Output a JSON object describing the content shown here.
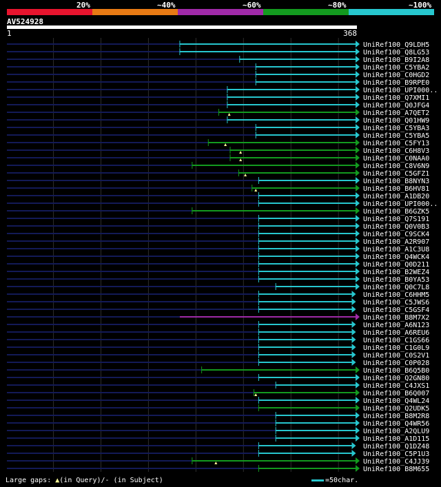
{
  "legend": [
    {
      "label": "20%",
      "color": "#e8142e"
    },
    {
      "label": "~40%",
      "color": "#e87a14"
    },
    {
      "label": "~60%",
      "color": "#a02aa8"
    },
    {
      "label": "~80%",
      "color": "#139a1f"
    },
    {
      "label": "~100%",
      "color": "#27c7cf"
    }
  ],
  "query": {
    "id": "AV524928",
    "length": 368,
    "start_label": "1",
    "end_label": "368"
  },
  "colors": {
    "cyan": "#27c7cf",
    "green": "#139a1f",
    "purple": "#a02aa8",
    "navy": "#131a57",
    "gap": "#ffff99"
  },
  "hits": [
    {
      "name": "UniRef100_Q9LDH5",
      "start": 183,
      "end": 368,
      "color": "cyan",
      "vline": true,
      "gaps": []
    },
    {
      "name": "UniRef100_Q8LG53",
      "start": 183,
      "end": 368,
      "color": "cyan",
      "vline": true,
      "gaps": []
    },
    {
      "name": "UniRef100_B9I2A8",
      "start": 246,
      "end": 368,
      "color": "cyan",
      "vline": true,
      "gaps": []
    },
    {
      "name": "UniRef100_C5YBA2",
      "start": 263,
      "end": 368,
      "color": "cyan",
      "vline": true,
      "gaps": []
    },
    {
      "name": "UniRef100_C0HGD2",
      "start": 263,
      "end": 368,
      "color": "cyan",
      "vline": true,
      "gaps": []
    },
    {
      "name": "UniRef100_B9RPE0",
      "start": 263,
      "end": 368,
      "color": "cyan",
      "vline": true,
      "gaps": []
    },
    {
      "name": "UniRef100_UPI000..",
      "start": 233,
      "end": 368,
      "color": "cyan",
      "vline": true,
      "gaps": []
    },
    {
      "name": "UniRef100_Q7XMI1",
      "start": 233,
      "end": 368,
      "color": "cyan",
      "vline": true,
      "gaps": []
    },
    {
      "name": "UniRef100_Q0JFG4",
      "start": 233,
      "end": 368,
      "color": "cyan",
      "vline": true,
      "gaps": []
    },
    {
      "name": "UniRef100_A7QET2",
      "start": 224,
      "end": 368,
      "color": "green",
      "vline": true,
      "gaps": [
        235
      ]
    },
    {
      "name": "UniRef100_Q01HW9",
      "start": 233,
      "end": 368,
      "color": "cyan",
      "vline": true,
      "gaps": []
    },
    {
      "name": "UniRef100_C5YBA3",
      "start": 263,
      "end": 368,
      "color": "cyan",
      "vline": true,
      "gaps": []
    },
    {
      "name": "UniRef100_C5YBA5",
      "start": 263,
      "end": 368,
      "color": "cyan",
      "vline": true,
      "gaps": []
    },
    {
      "name": "UniRef100_C5FY13",
      "start": 213,
      "end": 368,
      "color": "green",
      "vline": true,
      "gaps": [
        231
      ]
    },
    {
      "name": "UniRef100_C6H8V3",
      "start": 236,
      "end": 368,
      "color": "green",
      "vline": true,
      "gaps": [
        247
      ]
    },
    {
      "name": "UniRef100_C0NAA0",
      "start": 236,
      "end": 368,
      "color": "green",
      "vline": true,
      "gaps": [
        247
      ]
    },
    {
      "name": "UniRef100_C8V6N9",
      "start": 196,
      "end": 368,
      "color": "green",
      "vline": true,
      "gaps": []
    },
    {
      "name": "UniRef100_C5GFZ1",
      "start": 245,
      "end": 368,
      "color": "green",
      "vline": true,
      "gaps": [
        252
      ]
    },
    {
      "name": "UniRef100_B8NYN3",
      "start": 266,
      "end": 368,
      "color": "cyan",
      "vline": true,
      "gaps": []
    },
    {
      "name": "UniRef100_B6HV81",
      "start": 259,
      "end": 368,
      "color": "green",
      "vline": true,
      "gaps": [
        263
      ]
    },
    {
      "name": "UniRef100_A1DB20",
      "start": 266,
      "end": 368,
      "color": "cyan",
      "vline": true,
      "gaps": []
    },
    {
      "name": "UniRef100_UPI000..",
      "start": 266,
      "end": 368,
      "color": "cyan",
      "vline": true,
      "gaps": []
    },
    {
      "name": "UniRef100_B6GZK5",
      "start": 196,
      "end": 368,
      "color": "green",
      "vline": true,
      "gaps": []
    },
    {
      "name": "UniRef100_Q7S191",
      "start": 266,
      "end": 368,
      "color": "cyan",
      "vline": true,
      "gaps": []
    },
    {
      "name": "UniRef100_Q0V0B3",
      "start": 266,
      "end": 368,
      "color": "cyan",
      "vline": true,
      "gaps": []
    },
    {
      "name": "UniRef100_C9SCK4",
      "start": 266,
      "end": 368,
      "color": "cyan",
      "vline": true,
      "gaps": []
    },
    {
      "name": "UniRef100_A2R907",
      "start": 266,
      "end": 368,
      "color": "cyan",
      "vline": true,
      "gaps": []
    },
    {
      "name": "UniRef100_A1C3U8",
      "start": 266,
      "end": 368,
      "color": "cyan",
      "vline": true,
      "gaps": []
    },
    {
      "name": "UniRef100_Q4WCK4",
      "start": 266,
      "end": 368,
      "color": "cyan",
      "vline": true,
      "gaps": []
    },
    {
      "name": "UniRef100_Q0D211",
      "start": 266,
      "end": 368,
      "color": "cyan",
      "vline": true,
      "gaps": []
    },
    {
      "name": "UniRef100_B2WEZ4",
      "start": 266,
      "end": 368,
      "color": "cyan",
      "vline": true,
      "gaps": []
    },
    {
      "name": "UniRef100_B0YA53",
      "start": 266,
      "end": 368,
      "color": "cyan",
      "vline": true,
      "gaps": []
    },
    {
      "name": "UniRef100_Q0C7L8",
      "start": 284,
      "end": 368,
      "color": "cyan",
      "vline": true,
      "gaps": []
    },
    {
      "name": "UniRef100_C6HHM5",
      "start": 266,
      "end": 364,
      "color": "cyan",
      "vline": true,
      "gaps": []
    },
    {
      "name": "UniRef100_C5JWS6",
      "start": 266,
      "end": 364,
      "color": "cyan",
      "vline": true,
      "gaps": []
    },
    {
      "name": "UniRef100_C5GSF4",
      "start": 266,
      "end": 364,
      "color": "cyan",
      "vline": true,
      "gaps": []
    },
    {
      "name": "UniRef100_B8M7X2",
      "start": 183,
      "end": 368,
      "color": "purple",
      "vline": false,
      "gaps": []
    },
    {
      "name": "UniRef100_A6N123",
      "start": 266,
      "end": 364,
      "color": "cyan",
      "vline": true,
      "gaps": []
    },
    {
      "name": "UniRef100_A6REU6",
      "start": 266,
      "end": 364,
      "color": "cyan",
      "vline": true,
      "gaps": []
    },
    {
      "name": "UniRef100_C1GS66",
      "start": 266,
      "end": 364,
      "color": "cyan",
      "vline": true,
      "gaps": []
    },
    {
      "name": "UniRef100_C1G0L9",
      "start": 266,
      "end": 364,
      "color": "cyan",
      "vline": true,
      "gaps": []
    },
    {
      "name": "UniRef100_C0S2V1",
      "start": 266,
      "end": 364,
      "color": "cyan",
      "vline": true,
      "gaps": []
    },
    {
      "name": "UniRef100_C0P028",
      "start": 266,
      "end": 364,
      "color": "cyan",
      "vline": true,
      "gaps": []
    },
    {
      "name": "UniRef100_B6Q5B0",
      "start": 206,
      "end": 368,
      "color": "green",
      "vline": true,
      "gaps": []
    },
    {
      "name": "UniRef100_Q2GN80",
      "start": 266,
      "end": 368,
      "color": "cyan",
      "vline": true,
      "gaps": []
    },
    {
      "name": "UniRef100_C4JXS1",
      "start": 284,
      "end": 368,
      "color": "cyan",
      "vline": true,
      "gaps": []
    },
    {
      "name": "UniRef100_B6Q007",
      "start": 261,
      "end": 368,
      "color": "green",
      "vline": true,
      "gaps": [
        263
      ]
    },
    {
      "name": "UniRef100_Q4WL24",
      "start": 266,
      "end": 368,
      "color": "cyan",
      "vline": true,
      "gaps": []
    },
    {
      "name": "UniRef100_Q2UDK5",
      "start": 266,
      "end": 368,
      "color": "green",
      "vline": true,
      "gaps": []
    },
    {
      "name": "UniRef100_B8M2R8",
      "start": 284,
      "end": 368,
      "color": "cyan",
      "vline": true,
      "gaps": []
    },
    {
      "name": "UniRef100_Q4WR56",
      "start": 284,
      "end": 368,
      "color": "cyan",
      "vline": true,
      "gaps": []
    },
    {
      "name": "UniRef100_A2QLU9",
      "start": 284,
      "end": 368,
      "color": "cyan",
      "vline": true,
      "gaps": []
    },
    {
      "name": "UniRef100_A1D115",
      "start": 284,
      "end": 368,
      "color": "cyan",
      "vline": true,
      "gaps": []
    },
    {
      "name": "UniRef100_Q1DZ48",
      "start": 266,
      "end": 364,
      "color": "cyan",
      "vline": true,
      "gaps": []
    },
    {
      "name": "UniRef100_C5P1U3",
      "start": 266,
      "end": 364,
      "color": "cyan",
      "vline": true,
      "gaps": []
    },
    {
      "name": "UniRef100_C4JJ39",
      "start": 196,
      "end": 368,
      "color": "green",
      "vline": true,
      "gaps": [
        221
      ]
    },
    {
      "name": "UniRef100_B8M655",
      "start": 266,
      "end": 368,
      "color": "green",
      "vline": true,
      "gaps": []
    }
  ],
  "footer": {
    "gap_prefix": "Large gaps: ",
    "gap_symbol": "▲",
    "gap_text": "(in Query)/- (in Subject)",
    "scale_text": "=50char."
  }
}
